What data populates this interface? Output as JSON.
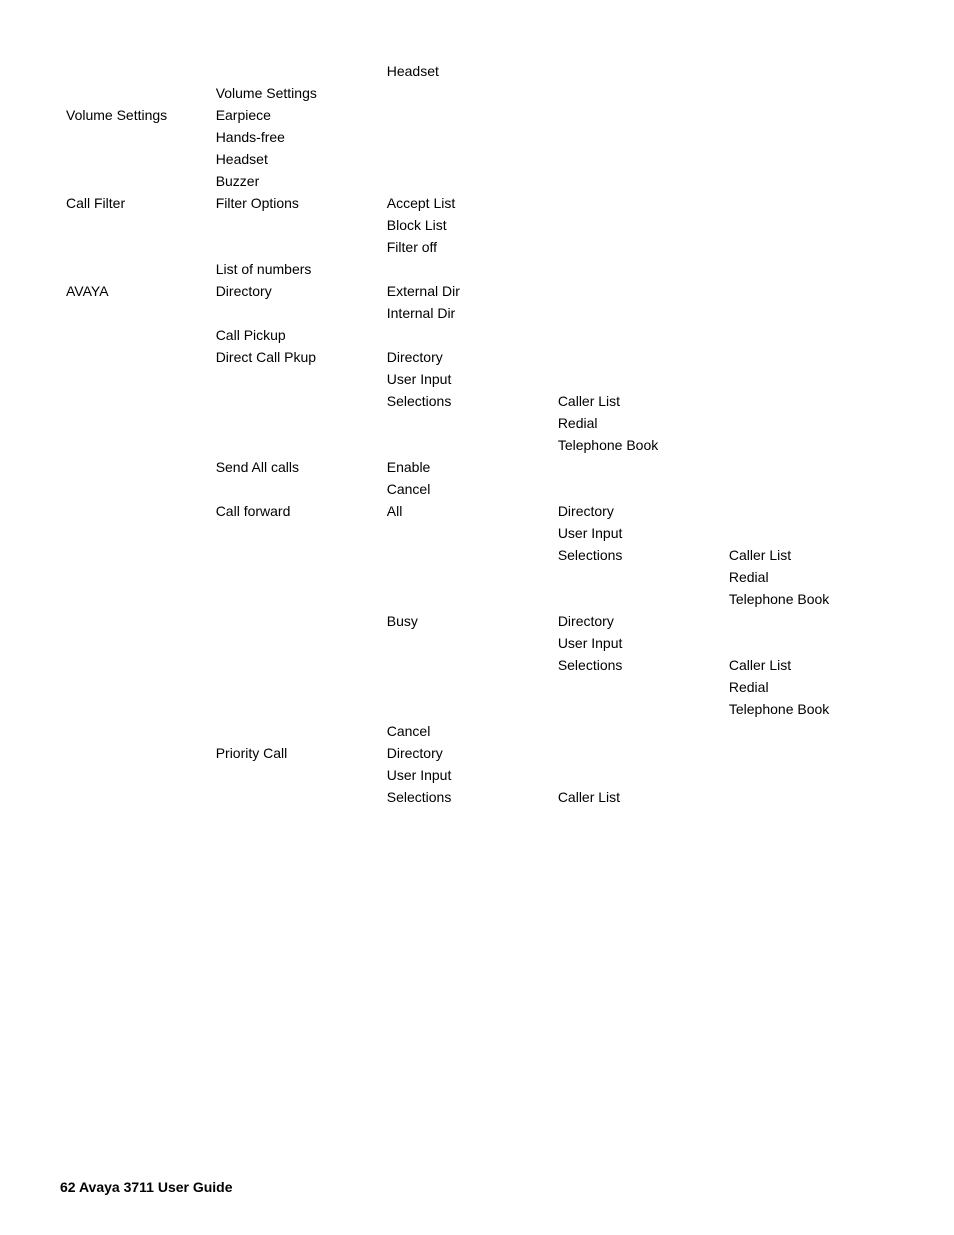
{
  "page": {
    "footer": "62   Avaya 3711 User Guide"
  },
  "rows": [
    {
      "col1": "",
      "col2": "",
      "col3": "Headset",
      "col4": "",
      "col5": ""
    },
    {
      "col1": "",
      "col2": "Volume Settings",
      "col3": "",
      "col4": "",
      "col5": ""
    },
    {
      "col1": "Volume Settings",
      "col2": "Earpiece",
      "col3": "",
      "col4": "",
      "col5": ""
    },
    {
      "col1": "",
      "col2": "Hands-free",
      "col3": "",
      "col4": "",
      "col5": ""
    },
    {
      "col1": "",
      "col2": "Headset",
      "col3": "",
      "col4": "",
      "col5": ""
    },
    {
      "col1": "",
      "col2": "Buzzer",
      "col3": "",
      "col4": "",
      "col5": ""
    },
    {
      "col1": "Call Filter",
      "col2": "Filter Options",
      "col3": "Accept List",
      "col4": "",
      "col5": ""
    },
    {
      "col1": "",
      "col2": "",
      "col3": "Block List",
      "col4": "",
      "col5": ""
    },
    {
      "col1": "",
      "col2": "",
      "col3": "Filter off",
      "col4": "",
      "col5": ""
    },
    {
      "col1": "",
      "col2": "List of numbers",
      "col3": "",
      "col4": "",
      "col5": ""
    },
    {
      "col1": "AVAYA",
      "col2": "Directory",
      "col3": "External Dir",
      "col4": "",
      "col5": ""
    },
    {
      "col1": "",
      "col2": "",
      "col3": "Internal Dir",
      "col4": "",
      "col5": ""
    },
    {
      "col1": "",
      "col2": "Call Pickup",
      "col3": "",
      "col4": "",
      "col5": ""
    },
    {
      "col1": "",
      "col2": "Direct Call Pkup",
      "col3": "Directory",
      "col4": "",
      "col5": ""
    },
    {
      "col1": "",
      "col2": "",
      "col3": "User Input",
      "col4": "",
      "col5": ""
    },
    {
      "col1": "",
      "col2": "",
      "col3": "Selections",
      "col4": "Caller List",
      "col5": ""
    },
    {
      "col1": "",
      "col2": "",
      "col3": "",
      "col4": "Redial",
      "col5": ""
    },
    {
      "col1": "",
      "col2": "",
      "col3": "",
      "col4": "Telephone Book",
      "col5": ""
    },
    {
      "col1": "",
      "col2": "Send All calls",
      "col3": "Enable",
      "col4": "",
      "col5": ""
    },
    {
      "col1": "",
      "col2": "",
      "col3": "Cancel",
      "col4": "",
      "col5": ""
    },
    {
      "col1": "",
      "col2": "Call forward",
      "col3": "All",
      "col4": "Directory",
      "col5": ""
    },
    {
      "col1": "",
      "col2": "",
      "col3": "",
      "col4": "User Input",
      "col5": ""
    },
    {
      "col1": "",
      "col2": "",
      "col3": "",
      "col4": "Selections",
      "col5": "Caller List"
    },
    {
      "col1": "",
      "col2": "",
      "col3": "",
      "col4": "",
      "col5": "Redial"
    },
    {
      "col1": "",
      "col2": "",
      "col3": "",
      "col4": "",
      "col5": "Telephone Book"
    },
    {
      "col1": "",
      "col2": "",
      "col3": "Busy",
      "col4": "Directory",
      "col5": ""
    },
    {
      "col1": "",
      "col2": "",
      "col3": "",
      "col4": "User Input",
      "col5": ""
    },
    {
      "col1": "",
      "col2": "",
      "col3": "",
      "col4": "Selections",
      "col5": "Caller List"
    },
    {
      "col1": "",
      "col2": "",
      "col3": "",
      "col4": "",
      "col5": "Redial"
    },
    {
      "col1": "",
      "col2": "",
      "col3": "",
      "col4": "",
      "col5": "Telephone Book"
    },
    {
      "col1": "",
      "col2": "",
      "col3": "Cancel",
      "col4": "",
      "col5": ""
    },
    {
      "col1": "",
      "col2": "Priority Call",
      "col3": "Directory",
      "col4": "",
      "col5": ""
    },
    {
      "col1": "",
      "col2": "",
      "col3": "User Input",
      "col4": "",
      "col5": ""
    },
    {
      "col1": "",
      "col2": "",
      "col3": "Selections",
      "col4": "Caller List",
      "col5": ""
    }
  ]
}
